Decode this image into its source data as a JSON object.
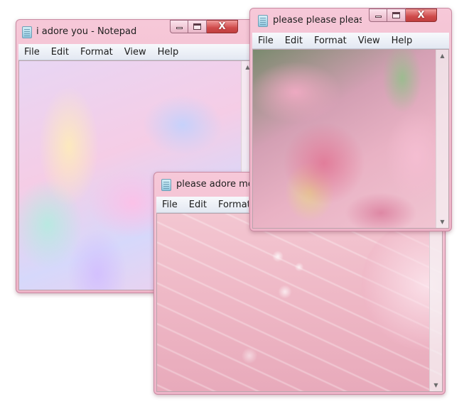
{
  "menu": {
    "file": "File",
    "edit": "Edit",
    "format": "Format",
    "view": "View",
    "help": "Help"
  },
  "windows": {
    "back": {
      "title": "i adore you - Notepad"
    },
    "front_bottom": {
      "title": "please adore me -"
    },
    "front_top": {
      "title": "please please please ..."
    }
  },
  "caption": {
    "close_glyph": "X"
  },
  "icons": {
    "app": "notepad-icon",
    "minimize": "minimize-icon",
    "maximize": "maximize-icon",
    "close": "close-icon",
    "scroll_up": "scroll-up-arrow-icon",
    "scroll_down": "scroll-down-arrow-icon"
  },
  "colors": {
    "titlebar": "#f3bfd1",
    "menubar": "#eef1f7",
    "close_button": "#cf4b4b"
  }
}
